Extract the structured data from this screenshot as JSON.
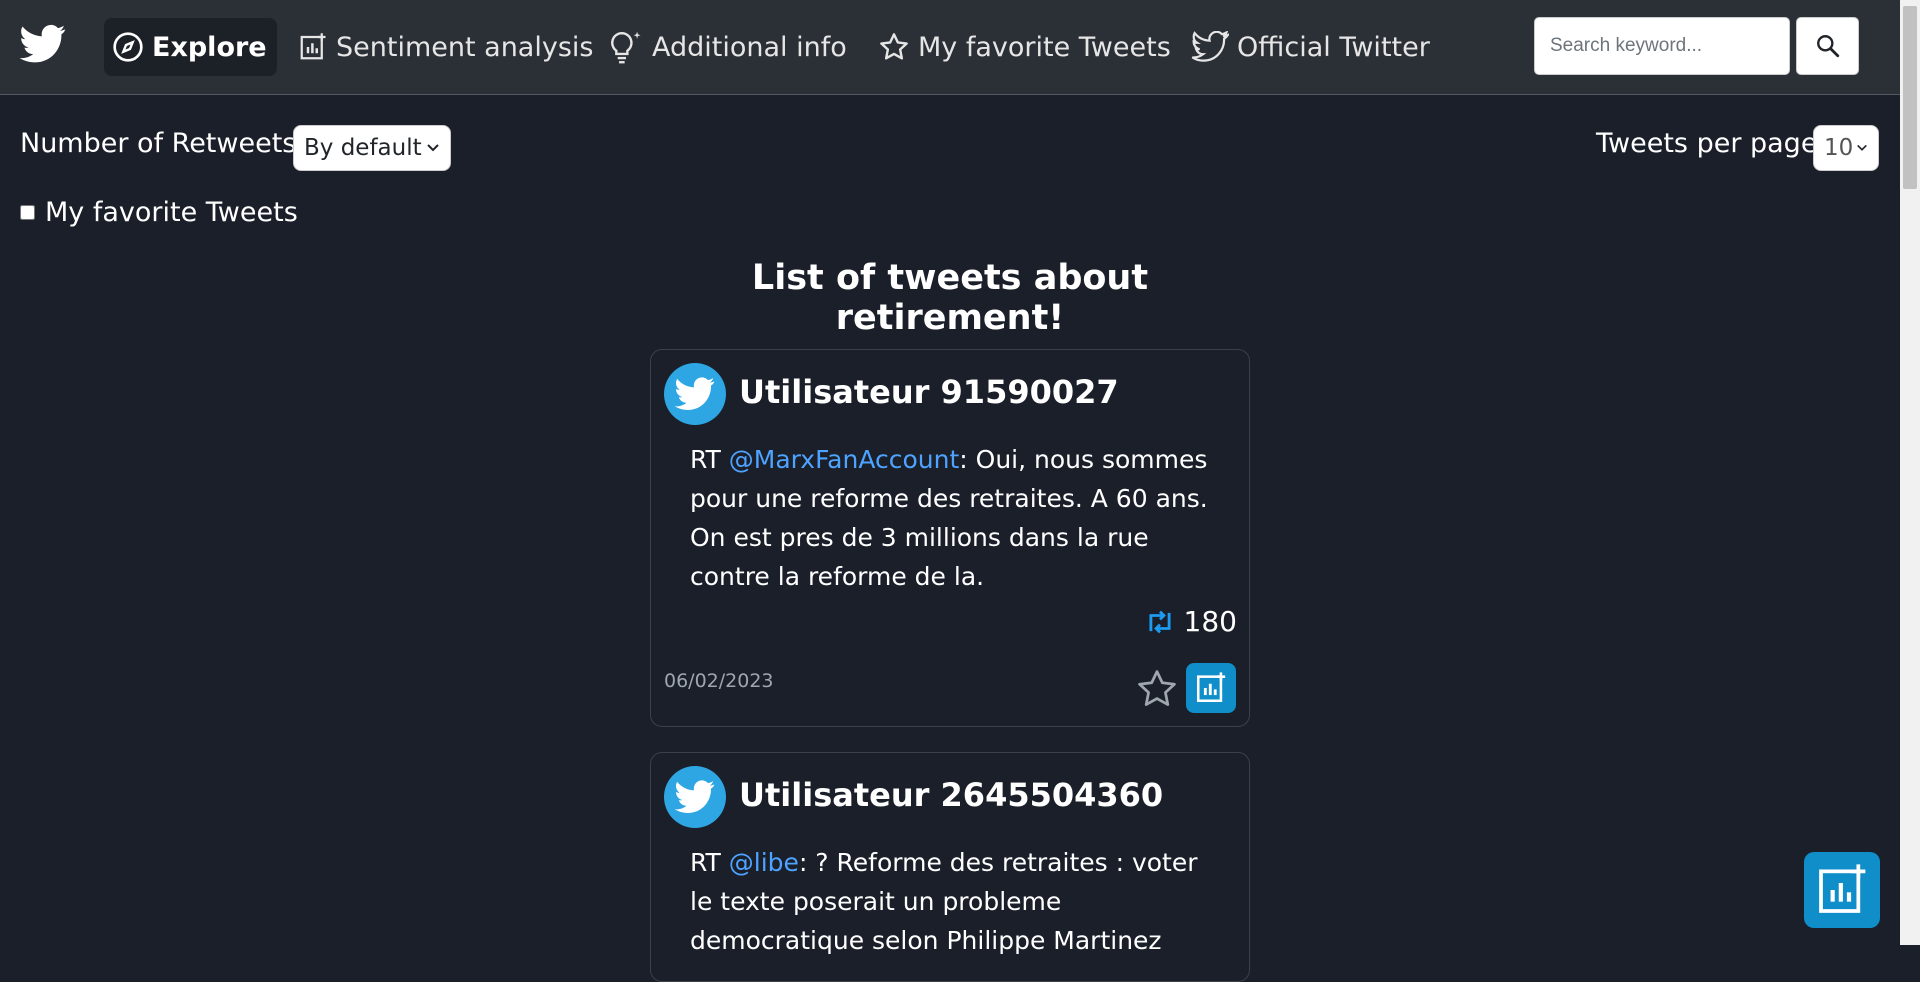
{
  "nav": {
    "items": [
      {
        "label": "Explore",
        "icon": "compass-icon",
        "active": true
      },
      {
        "label": "Sentiment analysis",
        "icon": "chart-icon"
      },
      {
        "label": "Additional info",
        "icon": "lightbulb-icon"
      },
      {
        "label": "My favorite Tweets",
        "icon": "star-icon"
      },
      {
        "label": "Official Twitter",
        "icon": "twitter-icon"
      }
    ],
    "search_placeholder": "Search keyword..."
  },
  "controls": {
    "sort_label": "Number of Retweets",
    "sort_value": "By default",
    "per_page_label": "Tweets per page",
    "per_page_value": "10",
    "favorites_filter_label": "My favorite Tweets"
  },
  "list": {
    "title": "List of tweets about retirement!",
    "tweets": [
      {
        "user": "Utilisateur 91590027",
        "prefix": "RT ",
        "mention": "@MarxFanAccount",
        "body": ": Oui, nous sommes pour une reforme des retraites. A 60 ans. On est pres de 3 millions dans la rue contre la reforme de la.",
        "retweets": "180",
        "date": "06/02/2023"
      },
      {
        "user": "Utilisateur 2645504360",
        "prefix": "RT ",
        "mention": "@libe",
        "body": ": ? Reforme des retraites : voter le texte poserait un probleme democratique selon Philippe Martinez"
      }
    ]
  },
  "colors": {
    "background": "#1a1f29",
    "navbar": "#2b2f36",
    "accent": "#0f8ec9",
    "mention": "#4da3ff",
    "avatar": "#2ea6e3"
  }
}
